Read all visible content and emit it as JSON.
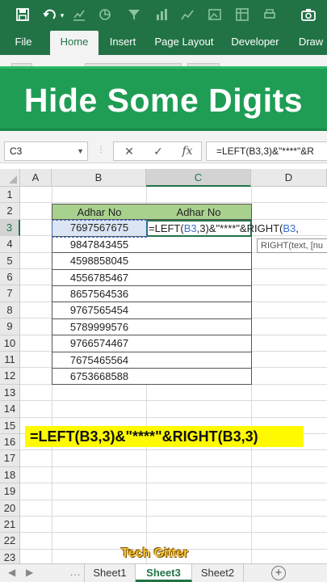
{
  "toolbar": {
    "icons": [
      "save-icon",
      "undo-icon",
      "redo-icon",
      "chart-icon",
      "filter-icon",
      "chart-icon",
      "picture-icon",
      "camera-icon"
    ]
  },
  "ribbon": {
    "tabs": [
      {
        "label": "File",
        "active": false
      },
      {
        "label": "Home",
        "active": true
      },
      {
        "label": "Insert",
        "active": false
      },
      {
        "label": "Page Layout",
        "active": false
      },
      {
        "label": "Developer",
        "active": false
      },
      {
        "label": "Draw",
        "active": false
      }
    ]
  },
  "banner": {
    "title": "Hide Some Digits"
  },
  "formula_bar": {
    "name_box": "C3",
    "cancel_symbol": "✕",
    "enter_symbol": "✓",
    "fx_symbol": "fx",
    "formula": "=LEFT(B3,3)&\"****\"&R"
  },
  "grid": {
    "columns": [
      "A",
      "B",
      "C",
      "D"
    ],
    "rows": [
      "1",
      "2",
      "3",
      "4",
      "5",
      "6",
      "7",
      "8",
      "9",
      "10",
      "11",
      "12",
      "13",
      "14",
      "15",
      "16",
      "17",
      "18",
      "19",
      "20",
      "21",
      "22",
      "23"
    ],
    "table": {
      "header_b": "Adhar No",
      "header_c": "Adhar No",
      "values": [
        "7697567675",
        "9847843455",
        "4598858045",
        "4556785467",
        "8657564536",
        "9767565454",
        "5789999576",
        "9766574467",
        "7675465564",
        "6753668588"
      ]
    },
    "edit_cell": {
      "part1": "=LEFT(",
      "ref1": "B3",
      "part2": ",3)&\"****\"&RIGHT(",
      "ref2": "B3",
      "part3": ","
    },
    "tooltip": "RIGHT(text, [nu"
  },
  "note": {
    "text": "=LEFT(B3,3)&\"****\"&RIGHT(B3,3)"
  },
  "watermark": "Tech Gitter",
  "sheets": {
    "tabs": [
      {
        "label": "Sheet1",
        "active": false
      },
      {
        "label": "Sheet3",
        "active": true
      },
      {
        "label": "Sheet2",
        "active": false
      }
    ],
    "add_symbol": "+"
  },
  "colors": {
    "excel_green": "#217346",
    "banner_green": "#1f9d55",
    "header_fill": "#a9d18e",
    "note_yellow": "#fffa00"
  }
}
